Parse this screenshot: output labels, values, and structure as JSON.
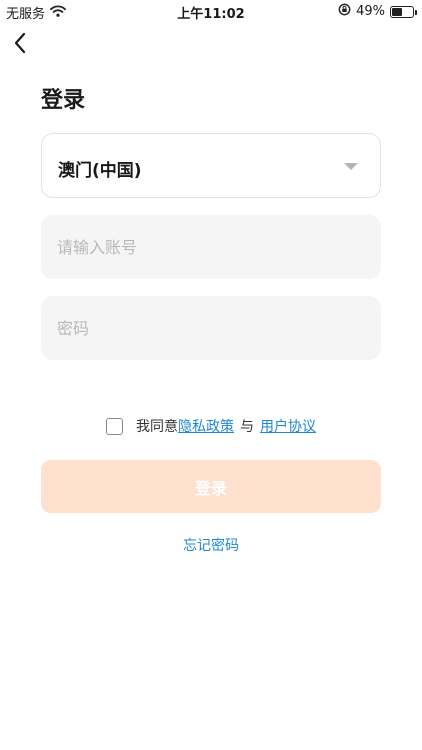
{
  "status_bar": {
    "carrier": "无服务",
    "time": "上午11:02",
    "battery_percent": "49%",
    "battery_level": 0.49
  },
  "header": {
    "back_icon": "chevron-left-icon",
    "title": "登录"
  },
  "form": {
    "region_value": "澳门(中国)",
    "account_placeholder": "请输入账号",
    "password_placeholder": "密码"
  },
  "agreement": {
    "prefix": "我同意",
    "privacy_policy": "隐私政策",
    "and": "与",
    "user_agreement": "用户协议",
    "checked": false
  },
  "actions": {
    "login_label": "登录",
    "forgot_password": "忘记密码"
  },
  "colors": {
    "link": "#1e88d6",
    "login_button_disabled": "#ffdfce",
    "field_background": "#f5f5f5"
  }
}
